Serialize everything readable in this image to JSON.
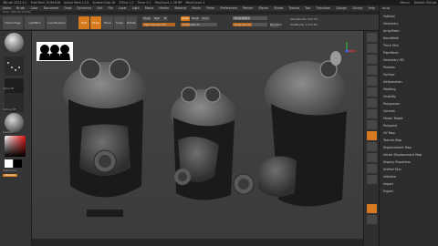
{
  "titlebar": {
    "app": "ZBrush 2021.5.1",
    "stats": [
      "Free Mem 15.894GB",
      "Active Mem 2.1G",
      "Scratch Disk 49",
      "ZTime 1.2",
      "Timer 0.2",
      "PolyCount 1.26 MP",
      "MeshCount 4"
    ],
    "right": [
      "Menus",
      "Default ZScript"
    ]
  },
  "menubar": [
    "Alpha",
    "Brush",
    "Color",
    "Document",
    "Draw",
    "Dynamics",
    "Edit",
    "File",
    "Layer",
    "Light",
    "Macro",
    "Marker",
    "Material",
    "Movie",
    "Picker",
    "Preferences",
    "Render",
    "Stencil",
    "Stroke",
    "Texture",
    "Tool",
    "Transform",
    "Zplugin",
    "Zscript",
    "Help"
  ],
  "subbar": "Draw : Material Modifier",
  "toolbar": {
    "home_label": "Home Page",
    "lightbox_label": "LightBox",
    "live_boolean_label": "Live Boolean",
    "edit_label": "Edit",
    "draw_label": "Draw",
    "move_label": "Move",
    "scale_label": "Scale",
    "rotate_label": "Rotate",
    "mrgb_label": "Mrgb",
    "rgb_label": "Rgb",
    "m_label": "M",
    "zadd_label": "Zadd",
    "zsub_label": "Zsub",
    "zcut_label": "Zcut",
    "rgb_intensity": "Rgb Intensity 100",
    "z_intensity": "Z Intensity 25",
    "focal_shift": "Focal Shift 0",
    "draw_size": "Draw Size 64",
    "dynamic_label": "Dynamic",
    "active_points": "ActivePoints: 379,712",
    "total_points": "TotalPoints: 1.273 Mil"
  },
  "toolbar_levels": {
    "rgb_intensity": 1.0,
    "z_intensity": 0.25,
    "focal_shift": 0.5,
    "draw_size": 0.55
  },
  "leftshelf": {
    "brush_label": "",
    "stroke_label": "",
    "alpha_label": "Alpha Off",
    "texture_label": "Texture Off",
    "material_label": "",
    "gradient_label": "Gradient",
    "switch_label": "SwitchColor",
    "alternate_label": "Alternate"
  },
  "rightpanel": {
    "header": "Scroll",
    "items": [
      "Subtool",
      "Geometry",
      "ArrayMesh",
      "NanoMesh",
      "Thick Skin",
      "FiberMesh",
      "Geometry HD",
      "Preview",
      "Surface",
      "Deformation",
      "Masking",
      "Visibility",
      "Polygroups",
      "Contact",
      "Morph Target",
      "Polypaint",
      "UV Map",
      "Texture Map",
      "Displacement Map",
      "Vector Displacement Map",
      "Display Properties",
      "Unified Skin",
      "Initialize",
      "Import",
      "Export"
    ]
  },
  "colors": {
    "accent": "#d67a1f",
    "canvas": "#444444",
    "panel": "#2c2c2c"
  }
}
